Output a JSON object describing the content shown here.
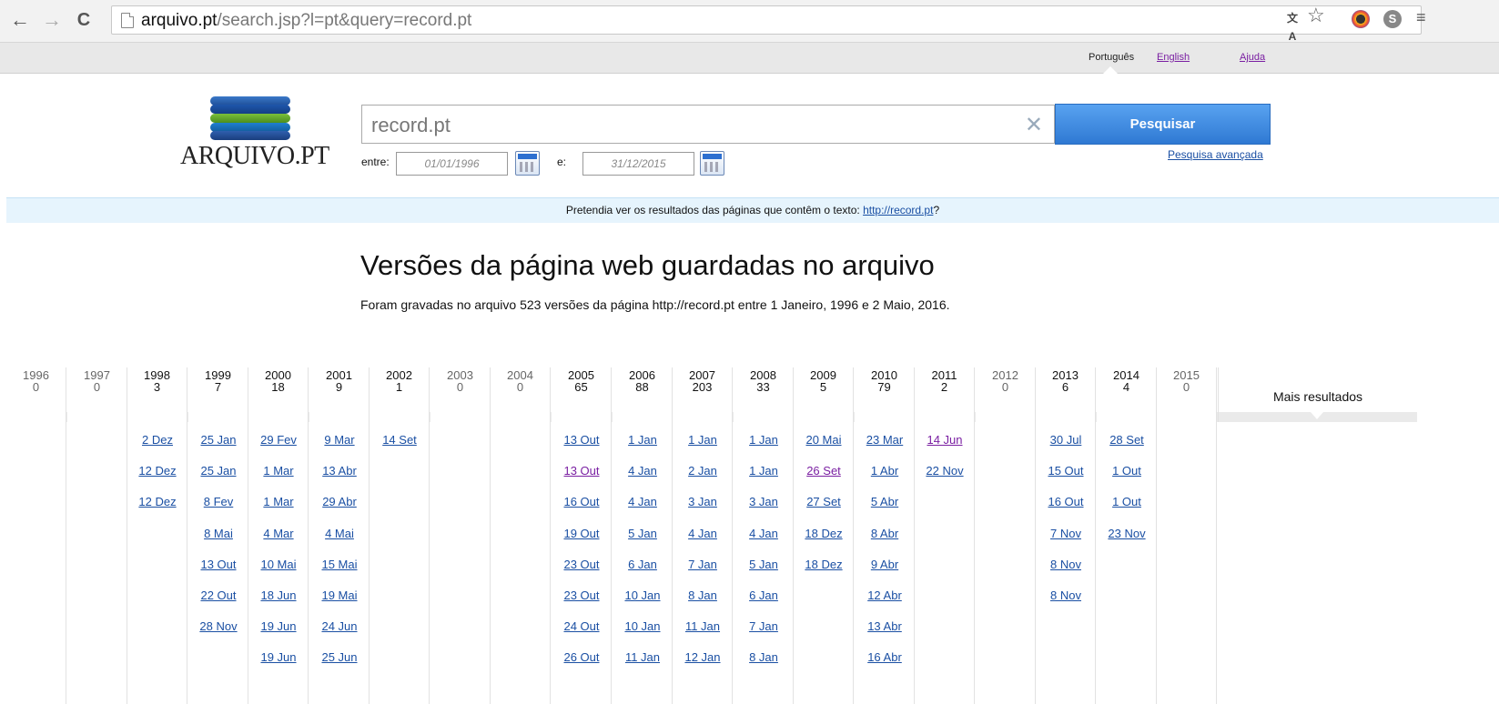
{
  "browser": {
    "url_host": "arquivo.pt",
    "url_path": "/search.jsp?l=pt&query=record.pt",
    "translate_icon": "translate-icon",
    "star_icon": "bookmark-star-icon",
    "menu_icon": "chrome-menu-icon"
  },
  "langbar": {
    "portuguese": "Português",
    "english": "English",
    "help": "Ajuda"
  },
  "logo": {
    "text": "ARQUIVO.PT"
  },
  "search": {
    "query": "record.pt",
    "clear": "✕",
    "button": "Pesquisar",
    "advanced": "Pesquisa avançada",
    "from_label": "entre:",
    "from_value": "01/01/1996",
    "to_label": "e:",
    "to_value": "31/12/2015"
  },
  "suggestion": {
    "prefix": "Pretendia ver os resultados das páginas que contêm o texto: ",
    "link": "http://record.pt",
    "suffix": "?"
  },
  "main": {
    "heading": "Versões da página web guardadas no arquivo",
    "subtext": "Foram gravadas no arquivo 523 versões da página http://record.pt entre 1 Janeiro, 1996 e 2 Maio, 2016."
  },
  "timeline": {
    "more_results": "Mais resultados",
    "years": [
      {
        "year": "1996",
        "count": "0",
        "versions": []
      },
      {
        "year": "1997",
        "count": "0",
        "versions": []
      },
      {
        "year": "1998",
        "count": "3",
        "versions": [
          "2 Dez",
          "12 Dez",
          "12 Dez"
        ]
      },
      {
        "year": "1999",
        "count": "7",
        "versions": [
          "25 Jan",
          "25 Jan",
          "8 Fev",
          "8 Mai",
          "13 Out",
          "22 Out",
          "28 Nov"
        ]
      },
      {
        "year": "2000",
        "count": "18",
        "versions": [
          "29 Fev",
          "1 Mar",
          "1 Mar",
          "4 Mar",
          "10 Mai",
          "18 Jun",
          "19 Jun",
          "19 Jun"
        ]
      },
      {
        "year": "2001",
        "count": "9",
        "versions": [
          "9 Mar",
          "13 Abr",
          "29 Abr",
          "4 Mai",
          "15 Mai",
          "19 Mai",
          "24 Jun",
          "25 Jun"
        ]
      },
      {
        "year": "2002",
        "count": "1",
        "versions": [
          "14 Set"
        ]
      },
      {
        "year": "2003",
        "count": "0",
        "versions": []
      },
      {
        "year": "2004",
        "count": "0",
        "versions": []
      },
      {
        "year": "2005",
        "count": "65",
        "versions": [
          "13 Out",
          "13 Out",
          "16 Out",
          "19 Out",
          "23 Out",
          "23 Out",
          "24 Out",
          "26 Out"
        ]
      },
      {
        "year": "2006",
        "count": "88",
        "versions": [
          "1 Jan",
          "4 Jan",
          "4 Jan",
          "5 Jan",
          "6 Jan",
          "10 Jan",
          "10 Jan",
          "11 Jan"
        ]
      },
      {
        "year": "2007",
        "count": "203",
        "versions": [
          "1 Jan",
          "2 Jan",
          "3 Jan",
          "4 Jan",
          "7 Jan",
          "8 Jan",
          "11 Jan",
          "12 Jan"
        ]
      },
      {
        "year": "2008",
        "count": "33",
        "versions": [
          "1 Jan",
          "1 Jan",
          "3 Jan",
          "4 Jan",
          "5 Jan",
          "6 Jan",
          "7 Jan",
          "8 Jan"
        ]
      },
      {
        "year": "2009",
        "count": "5",
        "versions": [
          "20 Mai",
          "26 Set",
          "27 Set",
          "18 Dez",
          "18 Dez"
        ]
      },
      {
        "year": "2010",
        "count": "79",
        "versions": [
          "23 Mar",
          "1 Abr",
          "5 Abr",
          "8 Abr",
          "9 Abr",
          "12 Abr",
          "13 Abr",
          "16 Abr"
        ]
      },
      {
        "year": "2011",
        "count": "2",
        "versions": [
          "14 Jun",
          "22 Nov"
        ]
      },
      {
        "year": "2012",
        "count": "0",
        "versions": []
      },
      {
        "year": "2013",
        "count": "6",
        "versions": [
          "30 Jul",
          "15 Out",
          "16 Out",
          "7 Nov",
          "8 Nov",
          "8 Nov"
        ]
      },
      {
        "year": "2014",
        "count": "4",
        "versions": [
          "28 Set",
          "1 Out",
          "1 Out",
          "23 Nov"
        ]
      },
      {
        "year": "2015",
        "count": "0",
        "versions": []
      }
    ],
    "visited": [
      {
        "col": 9,
        "row": 1
      },
      {
        "col": 13,
        "row": 1
      },
      {
        "col": 15,
        "row": 0
      }
    ]
  }
}
